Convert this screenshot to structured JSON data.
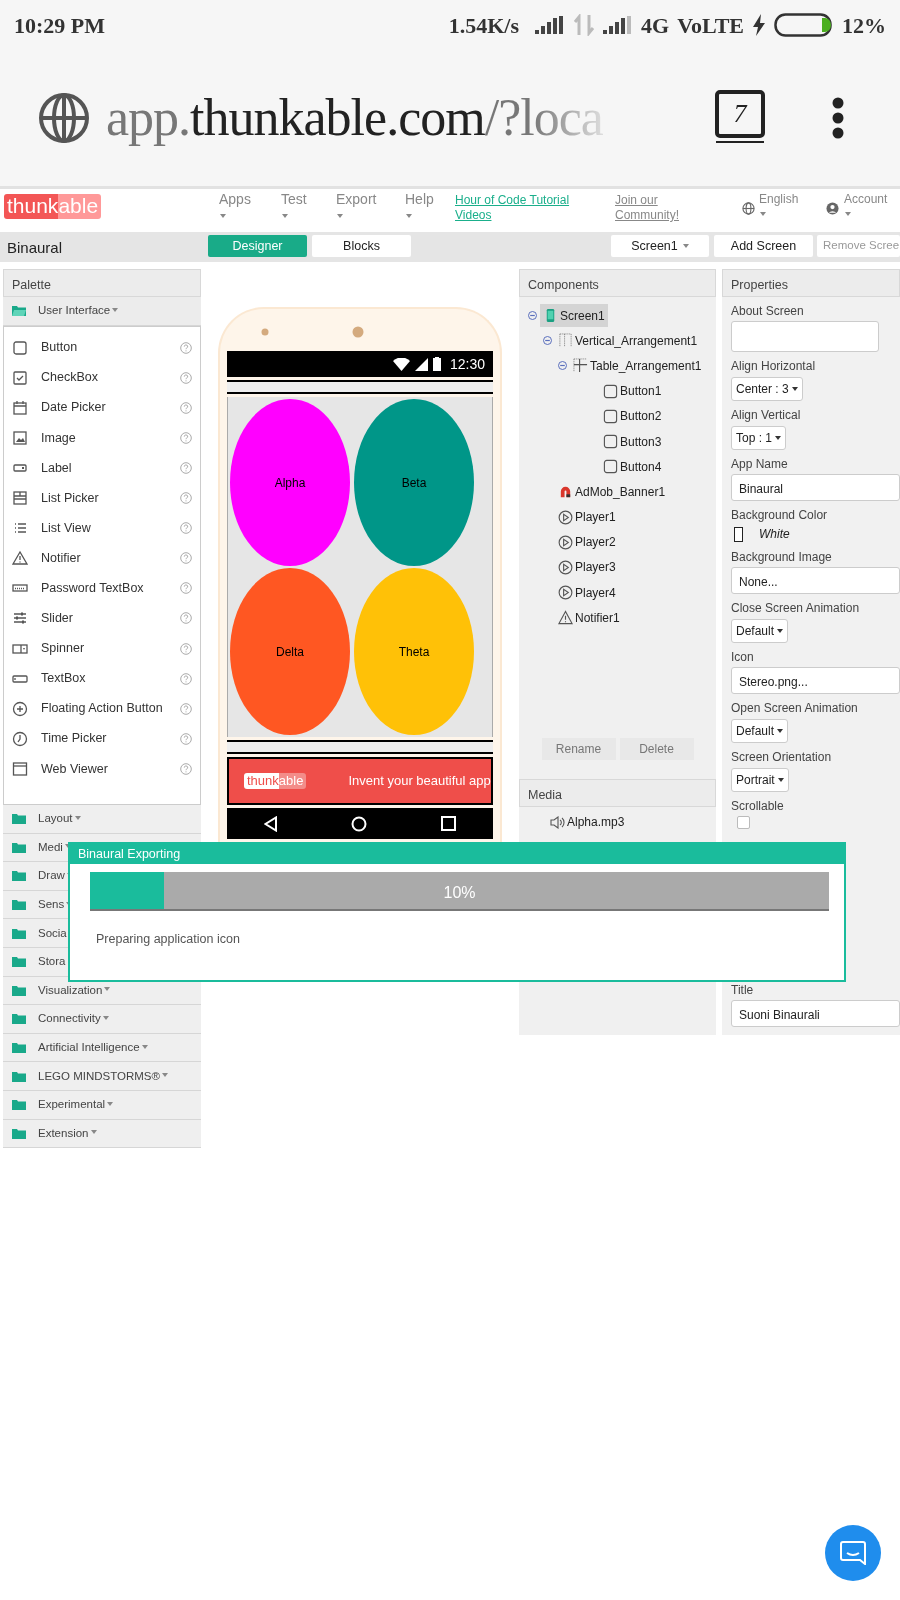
{
  "status_bar": {
    "time": "10:29 PM",
    "speed": "1.54K/s",
    "network": "4G",
    "volte": "VoLTE",
    "battery": "12%"
  },
  "browser": {
    "url": {
      "prefix": "app.",
      "domain": "thunkable.com",
      "path": "/?loca"
    },
    "tab_count": "7"
  },
  "header": {
    "logo": {
      "first": "thunk",
      "second": "able"
    },
    "menus": [
      {
        "label": "Apps"
      },
      {
        "label": "Test"
      },
      {
        "label": "Export"
      },
      {
        "label": "Help"
      }
    ],
    "tutorial_link": "Hour of Code Tutorial Videos",
    "community_link": "Join our Community!",
    "language": "English",
    "account": "Account"
  },
  "toolbar": {
    "project": "Binaural",
    "views": [
      {
        "label": "Designer",
        "selected": true
      },
      {
        "label": "Blocks",
        "selected": false
      }
    ],
    "screen_select": "Screen1",
    "add_screen": "Add Screen",
    "remove_screen": "Remove Scree"
  },
  "palette": {
    "title": "Palette",
    "categories": [
      {
        "label": "User Interface",
        "expanded": true,
        "items": [
          "Button",
          "CheckBox",
          "Date Picker",
          "Image",
          "Label",
          "List Picker",
          "List View",
          "Notifier",
          "Password TextBox",
          "Slider",
          "Spinner",
          "TextBox",
          "Floating Action Button",
          "Time Picker",
          "Web Viewer"
        ]
      },
      {
        "label": "Layout",
        "expanded": false
      },
      {
        "label": "Medi",
        "expanded": false
      },
      {
        "label": "Draw",
        "expanded": false
      },
      {
        "label": "Sens",
        "expanded": false
      },
      {
        "label": "Socia",
        "expanded": false
      },
      {
        "label": "Stora",
        "expanded": false
      },
      {
        "label": "Visualization",
        "expanded": false
      },
      {
        "label": "Connectivity",
        "expanded": false
      },
      {
        "label": "Artificial Intelligence",
        "expanded": false
      },
      {
        "label": "LEGO MINDSTORMS®",
        "expanded": false
      },
      {
        "label": "Experimental",
        "expanded": false
      },
      {
        "label": "Extension",
        "expanded": false
      }
    ]
  },
  "phone": {
    "time": "12:30",
    "buttons": [
      {
        "label": "Alpha",
        "color": "#ff00ff"
      },
      {
        "label": "Beta",
        "color": "#009688"
      },
      {
        "label": "Delta",
        "color": "#ff5722"
      },
      {
        "label": "Theta",
        "color": "#ffc107"
      }
    ],
    "banner": {
      "logo": {
        "first": "thunk",
        "second": "able"
      },
      "text": "Invent your beautiful app"
    }
  },
  "components": {
    "title": "Components",
    "tree": [
      {
        "label": "Screen1",
        "kind": "screen",
        "selected": true,
        "expanded": true,
        "children": [
          {
            "label": "Vertical_Arrangement1",
            "kind": "vertical",
            "selected": false,
            "expanded": true,
            "children": [
              {
                "label": "Table_Arrangement1",
                "kind": "table",
                "selected": false,
                "expanded": true,
                "children": [
                  {
                    "label": "Button1",
                    "kind": "button",
                    "selected": false
                  },
                  {
                    "label": "Button2",
                    "kind": "button",
                    "selected": false
                  },
                  {
                    "label": "Button3",
                    "kind": "button",
                    "selected": false
                  },
                  {
                    "label": "Button4",
                    "kind": "button",
                    "selected": false
                  }
                ]
              }
            ]
          },
          {
            "label": "AdMob_Banner1",
            "kind": "admob",
            "selected": false
          },
          {
            "label": "Player1",
            "kind": "player",
            "selected": false
          },
          {
            "label": "Player2",
            "kind": "player",
            "selected": false
          },
          {
            "label": "Player3",
            "kind": "player",
            "selected": false
          },
          {
            "label": "Player4",
            "kind": "player",
            "selected": false
          },
          {
            "label": "Notifier1",
            "kind": "notifier",
            "selected": false
          }
        ]
      }
    ],
    "buttons": [
      "Rename",
      "Delete"
    ]
  },
  "media": {
    "title": "Media",
    "files": [
      "Alpha.mp3"
    ]
  },
  "properties": {
    "title": "Properties",
    "items": [
      {
        "label": "About Screen",
        "kind": "textarea"
      },
      {
        "label": "Align Horizontal",
        "kind": "dropdown",
        "value": "Center : 3"
      },
      {
        "label": "Align Vertical",
        "kind": "dropdown",
        "value": "Top : 1"
      },
      {
        "label": "App Name",
        "kind": "text",
        "value": "Binaural"
      },
      {
        "label": "Background Color",
        "kind": "color",
        "value": "White",
        "color": "#ffffff"
      },
      {
        "label": "Background Image",
        "kind": "text",
        "value": "None..."
      },
      {
        "label": "Close Screen Animation",
        "kind": "dropdown",
        "value": "Default"
      },
      {
        "label": "Icon",
        "kind": "text",
        "value": "Stereo.png..."
      },
      {
        "label": "Open Screen Animation",
        "kind": "dropdown",
        "value": "Default"
      },
      {
        "label": "Screen Orientation",
        "kind": "dropdown",
        "value": "Portrait"
      },
      {
        "label": "Scrollable",
        "kind": "checkbox",
        "checked": false
      },
      {
        "label": "Title",
        "kind": "text",
        "value": "Suoni Binaurali"
      }
    ]
  },
  "dialog": {
    "title": "Binaural Exporting",
    "progress": {
      "level": 0.1,
      "reading": "10%"
    },
    "message": "Preparing application icon"
  }
}
